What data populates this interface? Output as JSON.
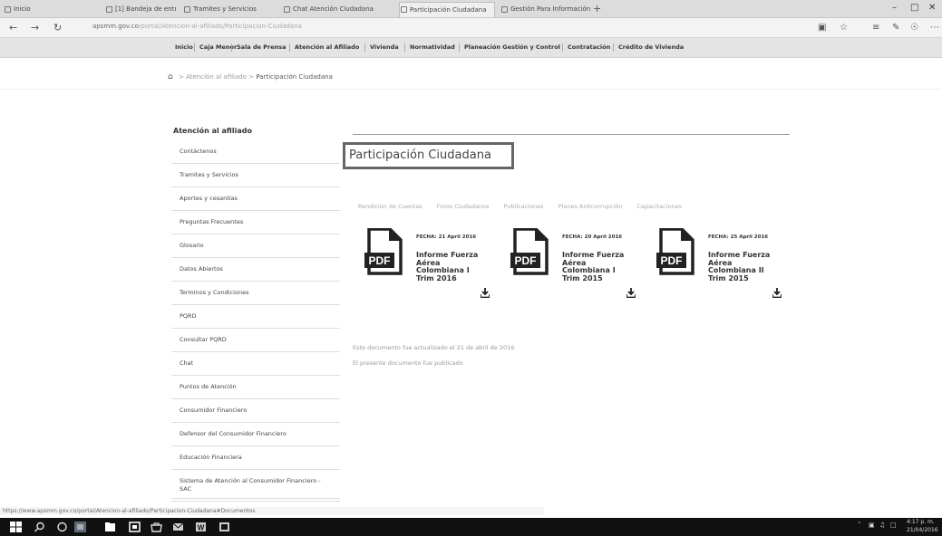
{
  "browser": {
    "tabs": [
      {
        "label": "Inicio"
      },
      {
        "label": "[1] Bandeja de entr..."
      },
      {
        "label": "Tramites y Servicios"
      },
      {
        "label": "Chat Atención Ciudadana"
      },
      {
        "label": "Participación Ciudadana"
      },
      {
        "label": "Gestión Para Información"
      }
    ],
    "new_tab": "+",
    "address": {
      "domain": "apsmm.gov.co",
      "rest": "/portal/Atencion-al-afiliado/Participacion-Ciudadana"
    },
    "status_url": "https://www.apsmm.gov.co/portal/Atencion-al-afiliado/Participacion-Ciudadana#Documentos"
  },
  "site_nav": {
    "items": [
      "Inicio",
      "Caja Menor",
      "Sala de Prensa",
      "Atención al Afiliado",
      "Vivienda",
      "Normatividad",
      "Planeación Gestión y Control",
      "Contratación",
      "Crédito de Vivienda"
    ]
  },
  "breadcrumb": {
    "parent": "Atención al afiliado",
    "separator": ">",
    "current": "Participación Ciudadana"
  },
  "sidebar": {
    "title": "Atención al afiliado",
    "items": [
      "Contáctenos",
      "Tramites y Servicios",
      "Aportes y cesantías",
      "Preguntas Frecuentes",
      "Glosario",
      "Datos Abiertos",
      "Terminos y Condiciones",
      "PQRD",
      "Consultar PQRD",
      "Chat",
      "Puntos de Atención",
      "Consumidor Financiero",
      "Defensor del Consumidor Financiero",
      "Educación Financiera",
      "Sistema de Atención al Consumidor Financiero - SAC"
    ]
  },
  "main": {
    "title": "Participación Ciudadana",
    "filters": [
      "Rendición de Cuentas",
      "Foros Ciudadanos",
      "Publicaciones",
      "Planes Anticorrupción",
      "Capacitaciones"
    ],
    "documents": [
      {
        "date": "FECHA: 21 April 2016",
        "title": "Informe Fuerza Aérea Colombiana I Trim 2016",
        "icon": "pdf-icon"
      },
      {
        "date": "FECHA: 20 April 2016",
        "title": "Informe Fuerza Aérea Colombiana I Trim 2015",
        "icon": "pdf-icon"
      },
      {
        "date": "FECHA: 25 April 2016",
        "title": "Informe Fuerza Aérea Colombiana II Trim 2015",
        "icon": "pdf-icon"
      }
    ],
    "pdf_badge": "PDF",
    "lines": [
      "Este documento fue actualizado el 21 de abril de 2016",
      "El presente documento fue publicado"
    ]
  },
  "taskbar": {
    "time": "4:17 p. m.",
    "date": "21/04/2016"
  },
  "colors": {
    "nav_bg": "#e4e4e4",
    "taskbar_bg": "#111111",
    "title_border": "#666666"
  }
}
